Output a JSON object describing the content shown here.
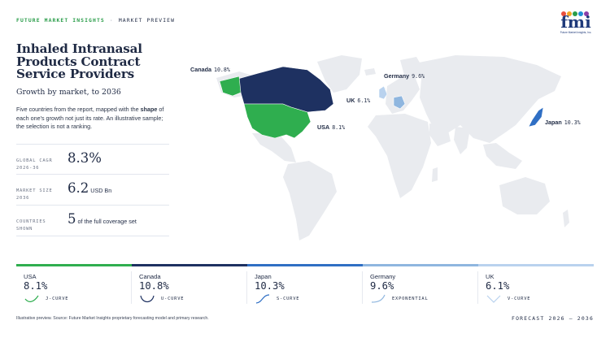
{
  "header": {
    "brand": "FUTURE MARKET INSIGHTS",
    "separator": "·",
    "section": "MARKET PREVIEW"
  },
  "logo": {
    "text": "fmi",
    "subtitle": "Future Market Insights, Inc.",
    "dot_colors": [
      "#e94e3c",
      "#f5a623",
      "#2a9d4a",
      "#1f8fd6",
      "#8b3fa8"
    ]
  },
  "title": "Inhaled Intranasal Products Contract Service Providers",
  "subtitle": "Growth by market, to 2036",
  "description": {
    "before": "Five countries from the report, mapped with the ",
    "bold": "shape",
    "after": " of each one's growth not just its rate. An illustrative sample; the selection is not a ranking."
  },
  "stats": [
    {
      "label": "GLOBAL CAGR 2026-36",
      "value": "8.3%",
      "unit": ""
    },
    {
      "label": "MARKET SIZE 2036",
      "value": "6.2",
      "unit": "USD Bn"
    },
    {
      "label": "COUNTRIES SHOWN",
      "value": "5",
      "unit": "of the full coverage set"
    }
  ],
  "colors": {
    "usa": "#2fae4f",
    "canada": "#1e3161",
    "japan": "#2f6fc4",
    "germany": "#8fb6df",
    "uk": "#b9d2ee",
    "land": "#e9ebef",
    "accent_green": "#2a9d4a"
  },
  "chart_data": {
    "type": "map",
    "title": "Inhaled Intranasal Products Contract Service Providers",
    "subtitle": "Growth by market, to 2036",
    "unit": "%",
    "series": [
      {
        "country": "USA",
        "value": 8.1,
        "label": "8.1%",
        "shape": "J-CURVE"
      },
      {
        "country": "Canada",
        "value": 10.8,
        "label": "10.8%",
        "shape": "U-CURVE"
      },
      {
        "country": "Japan",
        "value": 10.3,
        "label": "10.3%",
        "shape": "S-CURVE"
      },
      {
        "country": "Germany",
        "value": 9.6,
        "label": "9.6%",
        "shape": "EXPONENTIAL"
      },
      {
        "country": "UK",
        "value": 6.1,
        "label": "6.1%",
        "shape": "V-CURVE"
      }
    ]
  },
  "footnote": "Illustrative preview. Source: Future Market Insights proprietary forecasting model and primary research.",
  "forecast": "FORECAST 2026 – 2036"
}
